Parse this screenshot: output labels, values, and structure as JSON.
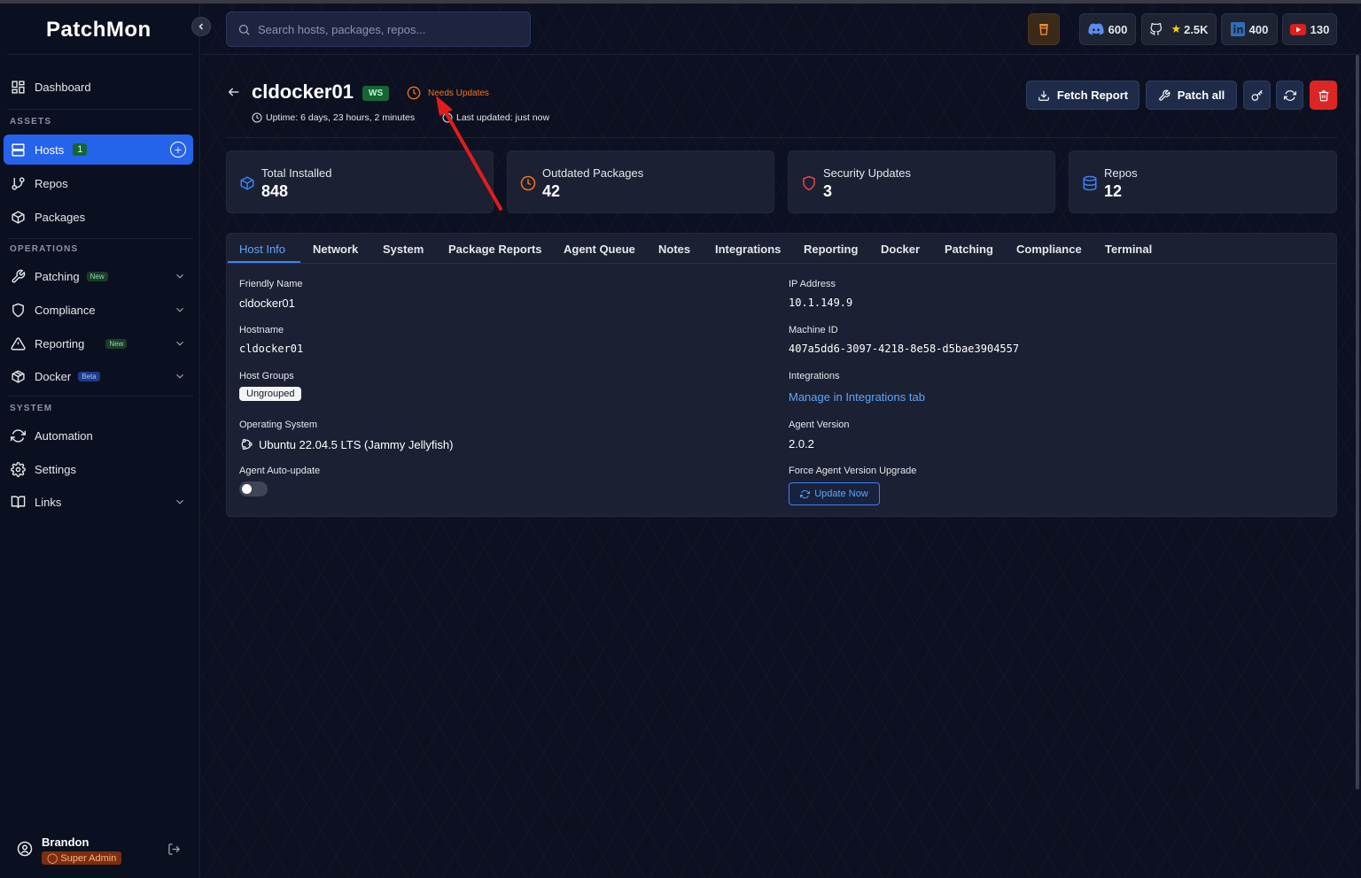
{
  "app": {
    "logo": "PatchMon"
  },
  "search": {
    "placeholder": "Search hosts, packages, repos..."
  },
  "topbar": {
    "discord_count": "600",
    "github_stars": "2.5K",
    "linkedin_count": "400",
    "youtube_count": "130"
  },
  "sidebar": {
    "dashboard": "Dashboard",
    "assets_label": "ASSETS",
    "hosts": "Hosts",
    "hosts_count": "1",
    "repos": "Repos",
    "packages": "Packages",
    "operations_label": "OPERATIONS",
    "patching": "Patching",
    "patching_badge": "New",
    "compliance": "Compliance",
    "reporting": "Reporting",
    "reporting_badge": "New",
    "docker": "Docker",
    "docker_badge": "Beta",
    "system_label": "SYSTEM",
    "automation": "Automation",
    "settings": "Settings",
    "links": "Links",
    "user_name": "Brandon",
    "user_role": "Super Admin"
  },
  "host": {
    "name": "cldocker01",
    "tag": "WS",
    "status": "Needs Updates",
    "uptime": "Uptime: 6 days, 23 hours, 2 minutes",
    "last_updated": "Last updated: just now"
  },
  "actions": {
    "fetch_report": "Fetch Report",
    "patch_all": "Patch all"
  },
  "stats": {
    "total_installed_label": "Total Installed",
    "total_installed": "848",
    "outdated_label": "Outdated Packages",
    "outdated": "42",
    "security_label": "Security Updates",
    "security": "3",
    "repos_label": "Repos",
    "repos": "12"
  },
  "tabs": [
    "Host Info",
    "Network",
    "System",
    "Package Reports",
    "Agent Queue",
    "Notes",
    "Integrations",
    "Reporting",
    "Docker",
    "Patching",
    "Compliance",
    "Terminal"
  ],
  "info": {
    "friendly_name_label": "Friendly Name",
    "friendly_name": "cldocker01",
    "hostname_label": "Hostname",
    "hostname": "cldocker01",
    "host_groups_label": "Host Groups",
    "host_group": "Ungrouped",
    "os_label": "Operating System",
    "os": "Ubuntu 22.04.5 LTS (Jammy Jellyfish)",
    "auto_update_label": "Agent Auto-update",
    "auto_update": false,
    "ip_label": "IP Address",
    "ip": "10.1.149.9",
    "machine_id_label": "Machine ID",
    "machine_id": "407a5dd6-3097-4218-8e58-d5bae3904557",
    "integrations_label": "Integrations",
    "integrations_link": "Manage in Integrations tab",
    "agent_version_label": "Agent Version",
    "agent_version": "2.0.2",
    "force_upgrade_label": "Force Agent Version Upgrade",
    "update_now": "Update Now"
  },
  "colors": {
    "accent": "#2563eb",
    "warning": "#f97316",
    "danger": "#dc2626",
    "success": "#166534",
    "annotation_arrow": "#e11d1d"
  }
}
